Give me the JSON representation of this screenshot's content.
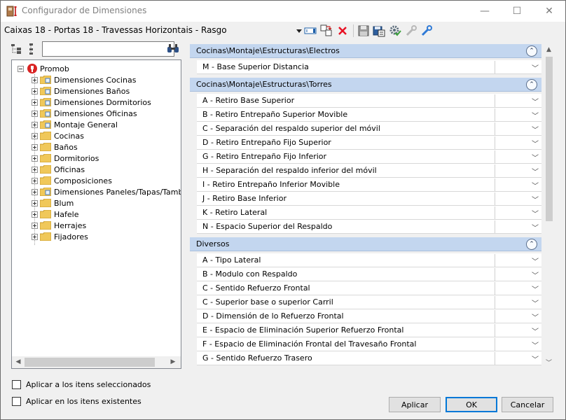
{
  "window": {
    "title": "Configurador de Dimensiones",
    "minimize_glyph": "—",
    "maximize_glyph": "☐",
    "close_glyph": "✕"
  },
  "toolbar": {
    "config_title": "Caixas 18 - Portas 18 - Travessas Horizontais - Rasgo",
    "icons": [
      "dropdown-arrow-icon",
      "text-field-icon",
      "copy-config-icon",
      "delete-icon",
      "save-icon",
      "save-as-icon",
      "settings-gear-icon",
      "tool-disabled-icon",
      "edit-tool-icon"
    ],
    "delete_color": "#e81123"
  },
  "search": {
    "placeholder": "",
    "value": "",
    "binoculars_glyph": "⚲"
  },
  "tree": {
    "root": {
      "label": "Promob"
    },
    "items": [
      {
        "label": "Dimensiones Cocinas"
      },
      {
        "label": "Dimensiones Baños"
      },
      {
        "label": "Dimensiones Dormitorios"
      },
      {
        "label": "Dimensiones Oficinas"
      },
      {
        "label": "Montaje General"
      },
      {
        "label": "Cocinas"
      },
      {
        "label": "Baños"
      },
      {
        "label": "Dormitorios"
      },
      {
        "label": "Oficinas"
      },
      {
        "label": "Composiciones"
      },
      {
        "label": "Dimensiones Paneles/Tapas/Tambur"
      },
      {
        "label": "Blum"
      },
      {
        "label": "Hafele"
      },
      {
        "label": "Herrajes"
      },
      {
        "label": "Fijadores"
      }
    ]
  },
  "groups": [
    {
      "title": "Cocinas\\Montaje\\Estructuras\\Electros",
      "rows": [
        {
          "label": "M - Base Superior Distancia",
          "value": ""
        }
      ]
    },
    {
      "title": "Cocinas\\Montaje\\Estructuras\\Torres",
      "rows": [
        {
          "label": "A - Retiro Base Superior",
          "value": ""
        },
        {
          "label": "B - Retiro Entrepaño Superior Movible",
          "value": ""
        },
        {
          "label": "C - Separación del respaldo superior del móvil",
          "value": ""
        },
        {
          "label": "D - Retiro Entrepaño Fijo Superior",
          "value": ""
        },
        {
          "label": "G - Retiro Entrepaño Fijo Inferior",
          "value": ""
        },
        {
          "label": "H - Separación del respaldo inferior del móvil",
          "value": ""
        },
        {
          "label": "I - Retiro Entrepaño Inferior Movible",
          "value": ""
        },
        {
          "label": "J - Retiro Base Inferior",
          "value": ""
        },
        {
          "label": "K - Retiro Lateral",
          "value": ""
        },
        {
          "label": "N - Espacio Superior del Respaldo",
          "value": ""
        }
      ]
    },
    {
      "title": "Diversos",
      "rows": [
        {
          "label": "A - Tipo Lateral",
          "value": ""
        },
        {
          "label": "B - Modulo con Respaldo",
          "value": ""
        },
        {
          "label": "C - Sentido Refuerzo Frontal",
          "value": ""
        },
        {
          "label": "C - Superior base o superior Carril",
          "value": ""
        },
        {
          "label": "D - Dimensión de lo Refuerzo Frontal",
          "value": ""
        },
        {
          "label": "E - Espacio de Eliminación Superior Refuerzo Frontal",
          "value": ""
        },
        {
          "label": "F - Espacio de Eliminación Frontal del Travesaño Frontal",
          "value": ""
        },
        {
          "label": "G - Sentido Refuerzo Trasero",
          "value": ""
        }
      ]
    }
  ],
  "options": {
    "apply_selected": "Aplicar a los itens seleccionados",
    "apply_existing": "Aplicar en los itens existentes",
    "apply_selected_checked": false,
    "apply_existing_checked": false
  },
  "buttons": {
    "apply": "Aplicar",
    "ok": "OK",
    "cancel": "Cancelar"
  },
  "colors": {
    "group_header": "#c3d6ef",
    "folder": "#f0c85a",
    "promob_red": "#d92323"
  }
}
